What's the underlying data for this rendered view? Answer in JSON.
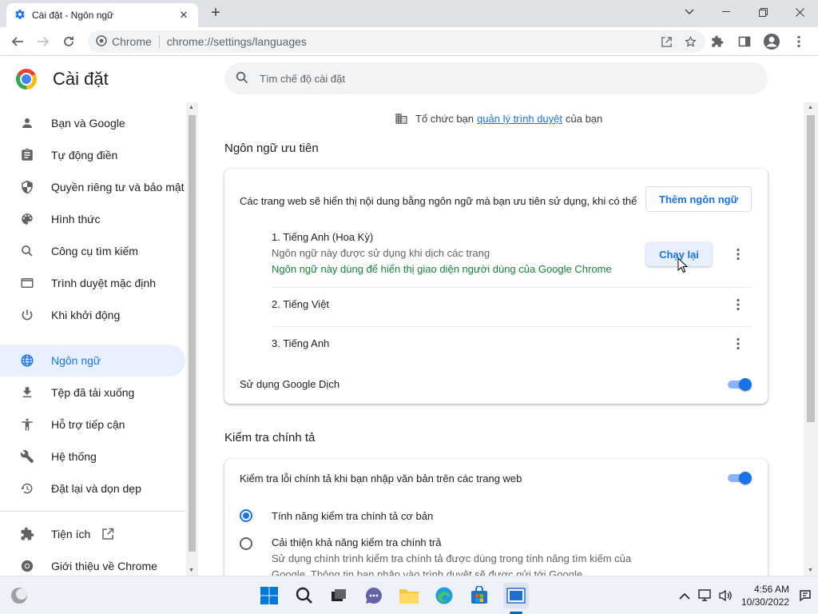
{
  "browser": {
    "tab_title": "Cài đặt - Ngôn ngữ",
    "omnibox_chip": "Chrome",
    "url": "chrome://settings/languages"
  },
  "header": {
    "title": "Cài đặt",
    "search_placeholder": "Tìm chế độ cài đặt"
  },
  "sidebar": {
    "items": [
      {
        "label": "Bạn và Google",
        "icon": "person-icon"
      },
      {
        "label": "Tự động điền",
        "icon": "clipboard-icon"
      },
      {
        "label": "Quyền riêng tư và bảo mật",
        "icon": "shield-icon"
      },
      {
        "label": "Hình thức",
        "icon": "palette-icon"
      },
      {
        "label": "Công cụ tìm kiếm",
        "icon": "search-icon"
      },
      {
        "label": "Trình duyệt mặc định",
        "icon": "browser-icon"
      },
      {
        "label": "Khi khởi động",
        "icon": "power-icon"
      },
      {
        "label": "Ngôn ngữ",
        "icon": "globe-icon",
        "active": true
      },
      {
        "label": "Tệp đã tải xuống",
        "icon": "download-icon"
      },
      {
        "label": "Hỗ trợ tiếp cận",
        "icon": "accessibility-icon"
      },
      {
        "label": "Hệ thống",
        "icon": "wrench-icon"
      },
      {
        "label": "Đặt lại và dọn dẹp",
        "icon": "restore-icon"
      },
      {
        "label": "Tiện ích",
        "icon": "puzzle-icon"
      },
      {
        "label": "Giới thiệu về Chrome",
        "icon": "chrome-icon"
      }
    ]
  },
  "main": {
    "managed_prefix": "Tổ chức bạn",
    "managed_link": "quản lý trình duyệt",
    "managed_suffix": "của bạn",
    "languages": {
      "section_title": "Ngôn ngữ ưu tiên",
      "description": "Các trang web sẽ hiển thị nội dung bằng ngôn ngữ mà bạn ưu tiên sử dụng, khi có thể",
      "add_button": "Thêm ngôn ngữ",
      "items": [
        {
          "name": "1. Tiếng Anh (Hoa Kỳ)",
          "sub": "Ngôn ngữ này được sử dụng khi dịch các trang",
          "note": "Ngôn ngữ này dùng để hiển thị giao diện người dùng của Google Chrome"
        },
        {
          "name": "2. Tiếng Việt"
        },
        {
          "name": "3. Tiếng Anh"
        }
      ],
      "relaunch_button": "Chạy lại",
      "translate_label": "Sử dụng Google Dịch",
      "translate_enabled": true
    },
    "spellcheck": {
      "section_title": "Kiểm tra chính tả",
      "toggle_label": "Kiểm tra lỗi chính tả khi bạn nhập văn bản trên các trang web",
      "toggle_enabled": true,
      "basic_label": "Tính năng kiểm tra chính tả cơ bản",
      "enhanced_label": "Cải thiện khả năng kiểm tra chính trả",
      "enhanced_desc_1": "Sử dụng chính trình kiểm tra chính tả được dùng trong tính năng tìm kiếm của",
      "enhanced_desc_2": "Google. Thông tin bạn nhập vào trình duyệt sẽ được gửi tới Google.",
      "selected": "basic"
    }
  },
  "taskbar": {
    "time": "4:56 AM",
    "date": "10/30/2022"
  },
  "colors": {
    "accent": "#1a73e8",
    "active_bg": "#e8f0fe",
    "green_note": "#188038"
  }
}
